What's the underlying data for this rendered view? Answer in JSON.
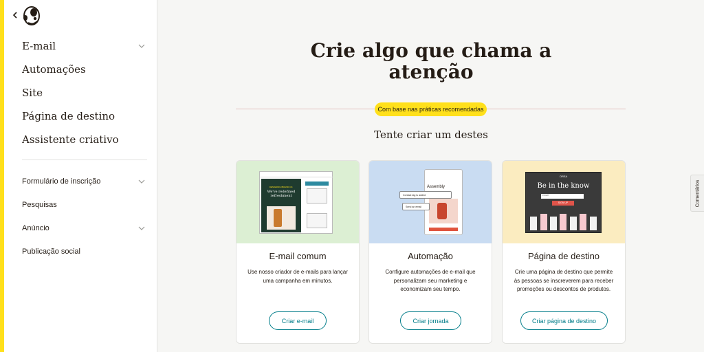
{
  "sidebar": {
    "primary": [
      {
        "label": "E-mail",
        "expandable": true
      },
      {
        "label": "Automações",
        "expandable": false
      },
      {
        "label": "Site",
        "expandable": false
      },
      {
        "label": "Página de destino",
        "expandable": false
      },
      {
        "label": "Assistente criativo",
        "expandable": false
      }
    ],
    "secondary": [
      {
        "label": "Formulário de inscrição",
        "expandable": true
      },
      {
        "label": "Pesquisas",
        "expandable": false
      },
      {
        "label": "Anúncio",
        "expandable": true
      },
      {
        "label": "Publicação social",
        "expandable": false
      }
    ]
  },
  "main": {
    "headline_line1": "Crie algo que chama a",
    "headline_line2": "atenção",
    "pill": "Com base nas práticas recomendadas",
    "subhead": "Tente criar um destes"
  },
  "cards": [
    {
      "title": "E-mail comum",
      "desc": "Use nosso criador de e-mails para lançar uma campanha em minutos.",
      "button": "Criar e-mail",
      "bg": "#dcefd3",
      "mock": {
        "title": "We've redefined refreshment",
        "kicker": "DESIGNING BRAND CO."
      }
    },
    {
      "title": "Automação",
      "desc": "Configure automações de e-mail que personalizam seu marketing e economizam seu tempo.",
      "button": "Criar jornada",
      "bg": "#c9dcf2",
      "mock": {
        "title": "Assembly",
        "chip1": "Contact tag is added",
        "chip2": "Send an email"
      }
    },
    {
      "title": "Página de destino",
      "desc": "Crie uma página de destino que permite às pessoas se inscreverem para receber promoções ou descontos de produtos.",
      "button": "Criar página de destino",
      "bg": "#fbecc0",
      "mock": {
        "title": "Be in the know",
        "brand": "OREA",
        "field": "email",
        "cta": "SIGN UP"
      }
    }
  ],
  "feedback": "Comentários",
  "colors": {
    "accent": "#ffe01b",
    "link": "#007c89",
    "text": "#241c15"
  }
}
